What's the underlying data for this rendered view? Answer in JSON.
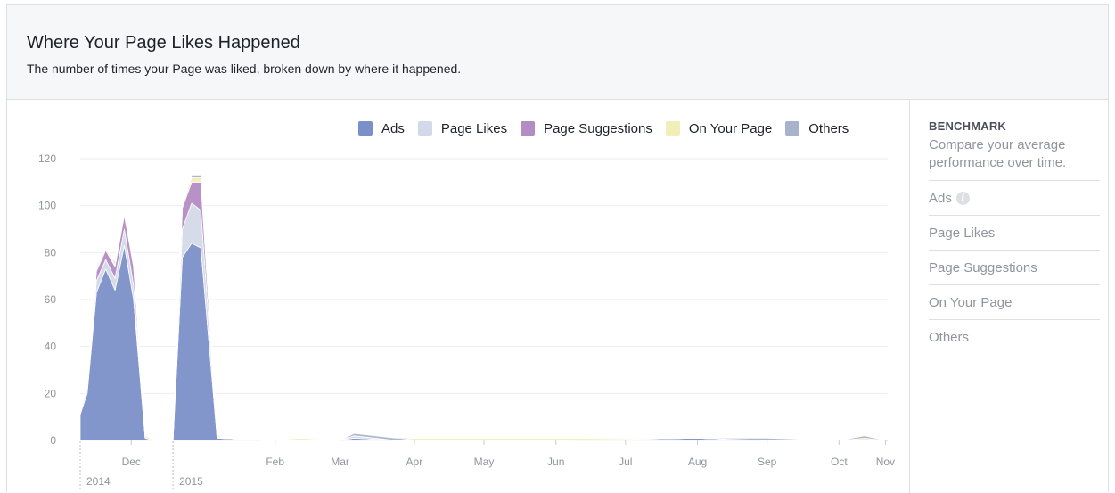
{
  "header": {
    "title": "Where Your Page Likes Happened",
    "subtitle": "The number of times your Page was liked, broken down by where it happened."
  },
  "legend": [
    {
      "label": "Ads",
      "color": "#7b90c8"
    },
    {
      "label": "Page Likes",
      "color": "#d3d9e8"
    },
    {
      "label": "Page Suggestions",
      "color": "#b48cc4"
    },
    {
      "label": "On Your Page",
      "color": "#f2eeb8"
    },
    {
      "label": "Others",
      "color": "#a7b3cc"
    }
  ],
  "benchmark": {
    "title": "BENCHMARK",
    "description": "Compare your average performance over time.",
    "items": [
      {
        "label": "Ads",
        "info_icon": "info-icon"
      },
      {
        "label": "Page Likes"
      },
      {
        "label": "Page Suggestions"
      },
      {
        "label": "On Your Page"
      },
      {
        "label": "Others"
      }
    ]
  },
  "chart_data": {
    "type": "area",
    "stacked": true,
    "ylim": [
      0,
      120
    ],
    "yticks": [
      0,
      20,
      40,
      60,
      80,
      100,
      120
    ],
    "x_unit": "date",
    "xlim": [
      "2014-11-22",
      "2015-11-05"
    ],
    "month_labels": [
      {
        "label": "Dec",
        "date": "2014-12-14"
      },
      {
        "label": "Feb",
        "date": "2015-02-14"
      },
      {
        "label": "Mar",
        "date": "2015-03-14"
      },
      {
        "label": "Apr",
        "date": "2015-04-15"
      },
      {
        "label": "May",
        "date": "2015-05-15"
      },
      {
        "label": "Jun",
        "date": "2015-06-15"
      },
      {
        "label": "Jul",
        "date": "2015-07-15"
      },
      {
        "label": "Aug",
        "date": "2015-08-15"
      },
      {
        "label": "Sep",
        "date": "2015-09-14"
      },
      {
        "label": "Oct",
        "date": "2015-10-15"
      },
      {
        "label": "Nov",
        "date": "2015-11-04"
      }
    ],
    "year_labels": [
      {
        "label": "2014",
        "date": "2014-11-22"
      },
      {
        "label": "2015",
        "date": "2015-01-01"
      }
    ],
    "x": [
      "2014-11-22",
      "2014-11-25",
      "2014-11-29",
      "2014-12-03",
      "2014-12-07",
      "2014-12-11",
      "2014-12-15",
      "2014-12-20",
      "2014-12-24",
      "2014-12-28",
      "2015-01-01",
      "2015-01-05",
      "2015-01-09",
      "2015-01-13",
      "2015-01-20",
      "2015-02-10",
      "2015-02-25",
      "2015-03-14",
      "2015-03-20",
      "2015-04-07",
      "2015-04-15",
      "2015-05-04",
      "2015-06-15",
      "2015-08-14",
      "2015-09-14",
      "2015-10-15",
      "2015-10-26",
      "2015-11-04"
    ],
    "series": [
      {
        "name": "Ads",
        "values": [
          11,
          20,
          63,
          73,
          64,
          83,
          60,
          1,
          0,
          0,
          0,
          78,
          84,
          82,
          1,
          0,
          0,
          0,
          1,
          0,
          0,
          0,
          0,
          1,
          0,
          0,
          0,
          0
        ]
      },
      {
        "name": "Page Likes",
        "values": [
          1,
          2,
          5,
          4,
          5,
          7,
          6,
          0,
          0,
          0,
          0,
          12,
          17,
          16,
          0,
          0,
          0,
          0,
          1,
          0,
          0,
          0,
          0,
          0,
          0,
          0,
          0,
          0
        ]
      },
      {
        "name": "Page Suggestions",
        "values": [
          0,
          1,
          4,
          4,
          5,
          6,
          8,
          0,
          0,
          0,
          0,
          9,
          9,
          12,
          0,
          0,
          0,
          0,
          0,
          0,
          0,
          0,
          0,
          0,
          0,
          0,
          0,
          0
        ]
      },
      {
        "name": "On Your Page",
        "values": [
          0,
          0,
          1,
          1,
          1,
          1,
          1,
          1,
          0,
          0,
          0,
          1,
          2,
          2,
          0,
          0,
          1,
          0,
          0,
          0,
          1,
          1,
          1,
          0,
          0,
          0,
          1,
          0
        ]
      },
      {
        "name": "Others",
        "values": [
          0,
          0,
          1,
          0,
          1,
          0,
          1,
          0,
          0,
          0,
          0,
          0,
          1,
          1,
          0,
          0,
          0,
          0,
          1,
          1,
          0,
          0,
          0,
          0,
          1,
          0,
          1,
          0
        ]
      }
    ]
  }
}
